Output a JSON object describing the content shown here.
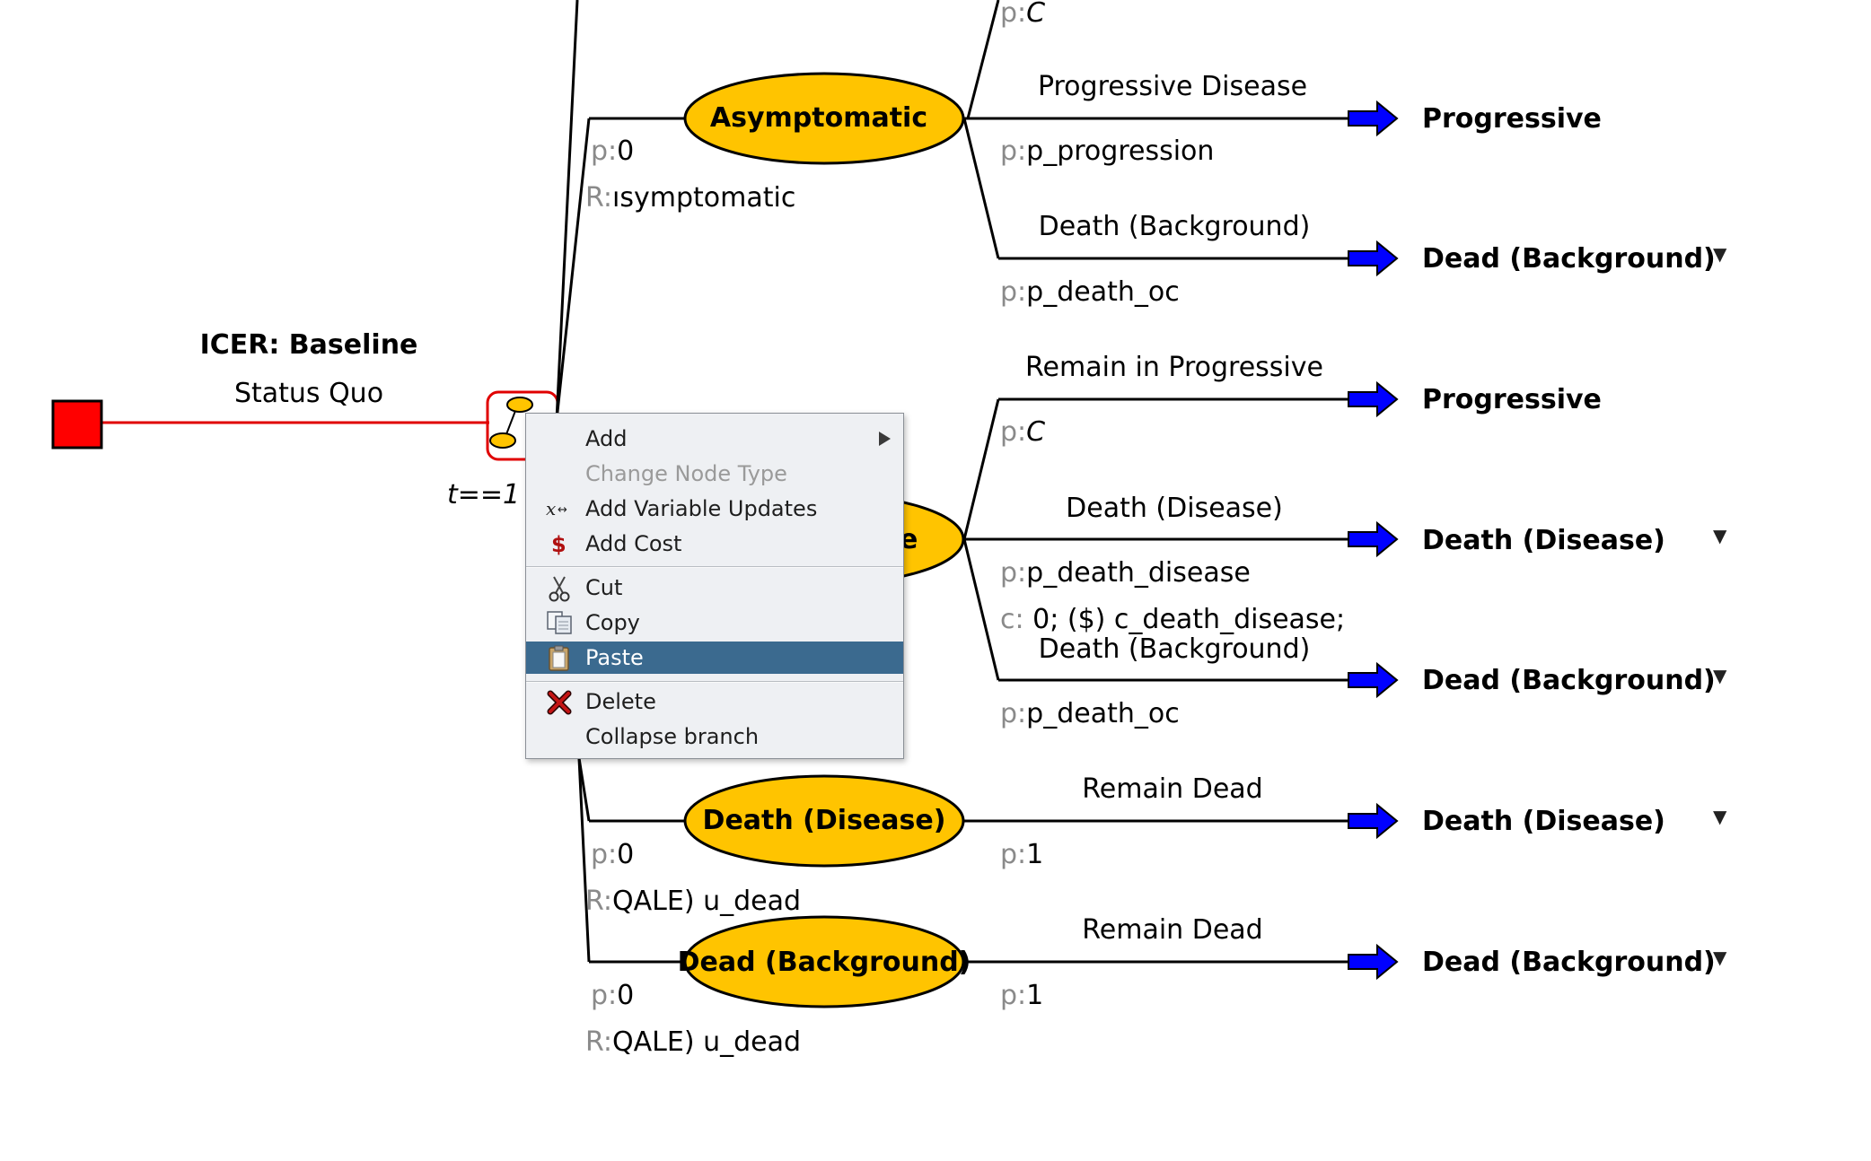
{
  "root": {
    "title": "ICER: Baseline",
    "subtitle": "Status Quo",
    "time_label": "t==1"
  },
  "states": {
    "asymptomatic": {
      "name": "Asymptomatic",
      "p_label": "p:",
      "p_value": "0",
      "r_label": "R:",
      "r_value": "ısymptomatic"
    },
    "progressive": {
      "name_partial": "e"
    },
    "death_disease": {
      "name": "Death (Disease)",
      "p_label": "p:",
      "p_value": "0",
      "r_label": "R:",
      "r_value": "QALE) u_dead"
    },
    "dead_background": {
      "name": "Dead (Background)",
      "p_label": "p:",
      "p_value": "0",
      "r_label": "R:",
      "r_value": "QALE) u_dead"
    }
  },
  "transitions": {
    "top": {
      "p_label": "p:",
      "p_value": "C"
    },
    "asym_progressive": {
      "name": "Progressive Disease",
      "p_label": "p:",
      "p_value": "p_progression",
      "target": "Progressive"
    },
    "asym_death_bg": {
      "name": "Death (Background)",
      "p_label": "p:",
      "p_value": "p_death_oc",
      "target": "Dead (Background)"
    },
    "prog_remain": {
      "name": "Remain in Progressive",
      "p_label": "p:",
      "p_value": "C",
      "target": "Progressive"
    },
    "prog_death_disease": {
      "name": "Death (Disease)",
      "p_label": "p:",
      "p_value": "p_death_disease",
      "c_label": "c:",
      "c_value": "0; ($) c_death_disease;",
      "target": "Death (Disease)"
    },
    "prog_death_bg": {
      "name": "Death (Background)",
      "p_label": "p:",
      "p_value": "p_death_oc",
      "target": "Dead (Background)"
    },
    "dd_remain": {
      "name": "Remain Dead",
      "p_label": "p:",
      "p_value": "1",
      "target": "Death (Disease)"
    },
    "db_remain": {
      "name": "Remain Dead",
      "p_label": "p:",
      "p_value": "1",
      "target": "Dead (Background)"
    }
  },
  "context_menu": {
    "items": [
      {
        "label": "Add",
        "icon": "none",
        "enabled": true,
        "submenu": true
      },
      {
        "label": "Change Node Type",
        "icon": "none",
        "enabled": false
      },
      {
        "label": "Add Variable Updates",
        "icon": "variable-update-icon",
        "enabled": true
      },
      {
        "label": "Add Cost",
        "icon": "dollar-icon",
        "enabled": true
      },
      {
        "label": "Cut",
        "icon": "scissors-icon",
        "enabled": true
      },
      {
        "label": "Copy",
        "icon": "copy-icon",
        "enabled": true
      },
      {
        "label": "Paste",
        "icon": "clipboard-icon",
        "enabled": true,
        "highlighted": true
      },
      {
        "label": "Delete",
        "icon": "red-x-icon",
        "enabled": true
      },
      {
        "label": "Collapse branch",
        "icon": "none",
        "enabled": true
      }
    ]
  },
  "colors": {
    "chance_node_fill": "#ffc400",
    "decision_node_fill": "#ff0000",
    "selection_outline": "#e00000",
    "terminal_arrow": "#0000ff",
    "menu_highlight": "#3b6a8f"
  }
}
